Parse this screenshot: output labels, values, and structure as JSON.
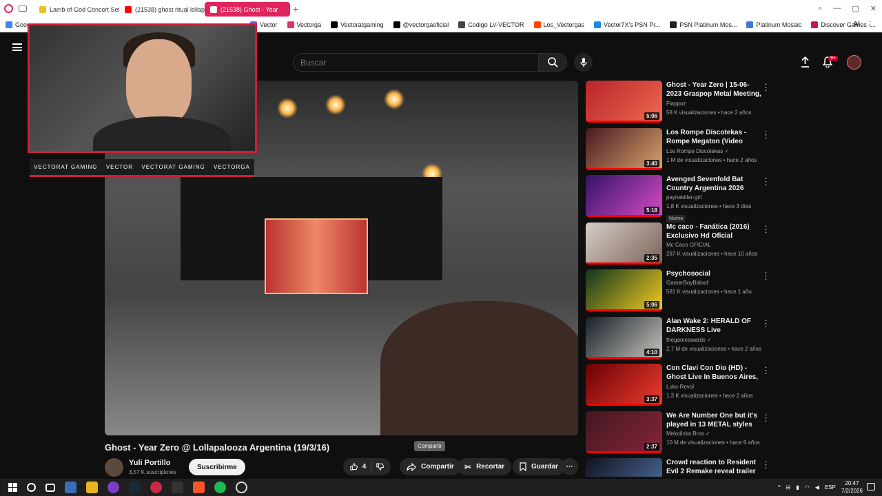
{
  "browser": {
    "tabs": [
      {
        "label": "Lamb of God Concert Set",
        "active": false
      },
      {
        "label": "(21538) ghost ritual lollap",
        "active": false
      },
      {
        "label": "(21538) Ghost - Year",
        "active": true
      }
    ],
    "new_tab": "+",
    "bookmarks": [
      "Vector",
      "Vectorga",
      "Vectoratgaming",
      "@vectorgaoficial",
      "Codigo LV-VECTOR",
      "Los_Vectorgas",
      "Vector7X's PSN Pr...",
      "PSN Platinum Mos...",
      "Platinum Mosaic",
      "Discover Games -..."
    ],
    "bookmark_first": "Goog",
    "bookmark_partial": "r",
    "ai_label": "AI"
  },
  "youtube": {
    "search_placeholder": "Buscar",
    "notification_count": "9+"
  },
  "overlay": {
    "socials": [
      "VECTORAT GAMING",
      "VECTOR",
      "VECTORAT GAMING",
      "VECTORGA"
    ]
  },
  "video": {
    "title": "Ghost - Year Zero @ Lollapalooza Argentina (19/3/16)",
    "channel": "Yuli Portillo",
    "subscribers": "3,57 K suscriptores",
    "subscribe_label": "Suscribirme",
    "likes": "4",
    "share_label": "Compartir",
    "clip_label": "Recortar",
    "save_label": "Guardar",
    "tooltip": "Compartir"
  },
  "related": [
    {
      "title": "Ghost - Year Zero | 15-06-2023 Graspop Metal Meeting, Desse...",
      "channel": "Flappoz",
      "stats": "58 K visualizaciones • hace 2 años",
      "duration": "5:06",
      "colors": [
        "#b8242a",
        "#f06a4f"
      ]
    },
    {
      "title": "Los Rompe Discotekas - Rompe Megaton (Video Oficial)",
      "channel": "Los Rompe Discotekas",
      "stats": "1 M de visualizaciones • hace 2 años",
      "duration": "3:40",
      "colors": [
        "#4a1722",
        "#d8a56b"
      ],
      "verified": true
    },
    {
      "title": "Avenged Sevenfold Bat Country Argentina 2026",
      "channel": "paynekiller-girl",
      "stats": "1,8 K visualizaciones • hace 3 días",
      "duration": "5:18",
      "badge": "Nuevo",
      "colors": [
        "#321467",
        "#d94bc5"
      ]
    },
    {
      "title": "Mc caco - Fanática (2016) Exclusivo Hd Oficial",
      "channel": "Mc Caco OFICIAL",
      "stats": "287 K visualizaciones • hace 10 años",
      "duration": "2:35",
      "colors": [
        "#d6ccc7",
        "#7b6459"
      ]
    },
    {
      "title": "Psychosocial",
      "channel": "GamerBoyBidoof",
      "stats": "581 K visualizaciones • hace 1 año",
      "duration": "5:06",
      "colors": [
        "#0e351d",
        "#f5cc21"
      ]
    },
    {
      "title": "Alan Wake 2: HERALD OF DARKNESS Live Performance ...",
      "channel": "thegameawards",
      "stats": "2,7 M de visualizaciones • hace 2 años",
      "duration": "4:10",
      "colors": [
        "#161f28",
        "#c9c5bd"
      ],
      "verified": true
    },
    {
      "title": "Con Clavi Con Dio (HD) - Ghost Live In Buenos Aires, Argentin...",
      "channel": "Luks-Revol",
      "stats": "1,3 K visualizaciones • hace 2 años",
      "duration": "3:37",
      "colors": [
        "#690006",
        "#ef3d2c"
      ]
    },
    {
      "title": "We Are Number One but it's played in 13 METAL styles",
      "channel": "Melodicka Bros",
      "stats": "10 M de visualizaciones • hace 9 años",
      "duration": "2:37",
      "colors": [
        "#421820",
        "#88243b"
      ],
      "verified": true
    },
    {
      "title": "Crowd reaction to Resident Evil 2 Remake reveal trailer at ...",
      "channel": "",
      "stats": "",
      "duration": "",
      "colors": [
        "#12121f",
        "#4f75a5"
      ]
    }
  ],
  "taskbar": {
    "lang": "ESP",
    "time": "20:47",
    "date": "7/2/2026"
  }
}
